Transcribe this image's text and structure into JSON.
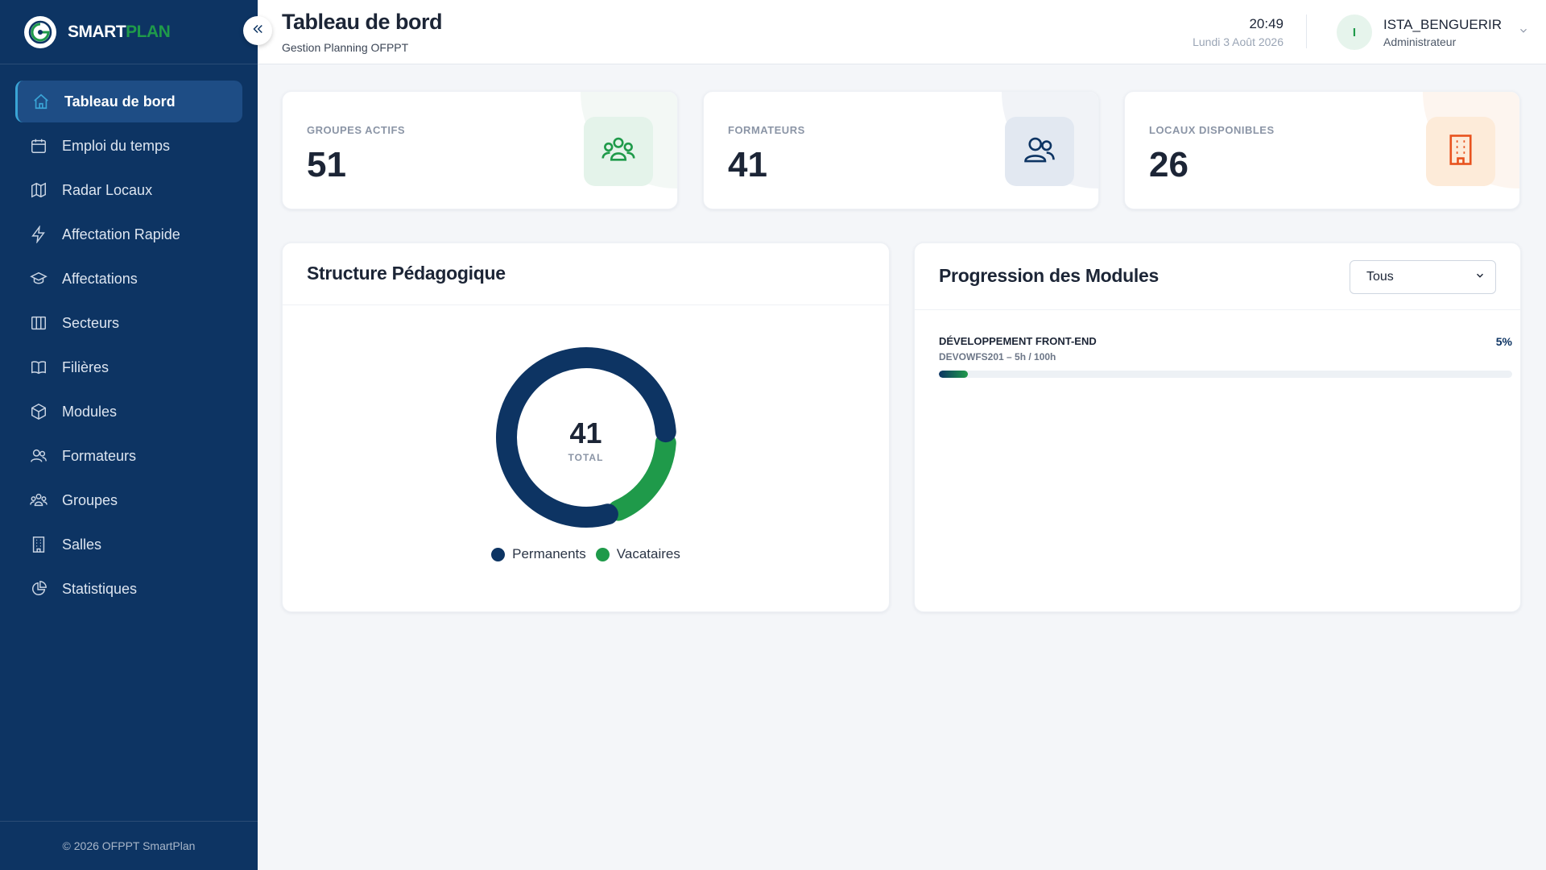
{
  "brand": {
    "part1": "SMART",
    "part2": "PLAN",
    "colors": {
      "navy": "#0d3463",
      "green": "#1f9a4a"
    }
  },
  "sidebar": {
    "items": [
      {
        "label": "Tableau de bord",
        "icon": "home-icon",
        "active": true
      },
      {
        "label": "Emploi du temps",
        "icon": "calendar-icon"
      },
      {
        "label": "Radar Locaux",
        "icon": "map-icon"
      },
      {
        "label": "Affectation Rapide",
        "icon": "lightning-icon"
      },
      {
        "label": "Affectations",
        "icon": "graduation-cap-icon"
      },
      {
        "label": "Secteurs",
        "icon": "columns-icon"
      },
      {
        "label": "Filières",
        "icon": "book-open-icon"
      },
      {
        "label": "Modules",
        "icon": "cube-icon"
      },
      {
        "label": "Formateurs",
        "icon": "users-icon"
      },
      {
        "label": "Groupes",
        "icon": "group-icon"
      },
      {
        "label": "Salles",
        "icon": "building-icon"
      },
      {
        "label": "Statistiques",
        "icon": "pie-chart-icon"
      }
    ],
    "footer": "© 2026 OFPPT SmartPlan"
  },
  "header": {
    "title": "Tableau de bord",
    "subtitle": "Gestion Planning OFPPT",
    "time": "20:49",
    "date": "Lundi 3 Août 2026",
    "user": {
      "initial": "I",
      "name": "ISTA_BENGUERIR",
      "role": "Administrateur"
    }
  },
  "stats": [
    {
      "label": "GROUPES ACTIFS",
      "value": "51",
      "icon": "group-icon",
      "color": "#1f9a4a"
    },
    {
      "label": "FORMATEURS",
      "value": "41",
      "icon": "users-icon",
      "color": "#0d3463"
    },
    {
      "label": "LOCAUX DISPONIBLES",
      "value": "26",
      "icon": "building-icon",
      "color": "#e8531f"
    }
  ],
  "structure": {
    "title": "Structure Pédagogique",
    "total": "41",
    "total_label": "TOTAL",
    "legend": [
      {
        "label": "Permanents",
        "color": "#0d3463"
      },
      {
        "label": "Vacataires",
        "color": "#1f9a4a"
      }
    ]
  },
  "chart_data": {
    "type": "pie",
    "categories": [
      "Permanents",
      "Vacataires"
    ],
    "values": [
      33,
      8
    ],
    "total": 41
  },
  "progression": {
    "title": "Progression des Modules",
    "filter": "Tous",
    "modules": [
      {
        "name": "DÉVELOPPEMENT FRONT-END",
        "code": "DEVOWFS201 – 5h / 100h",
        "percent_label": "5%",
        "percent": 5
      }
    ]
  }
}
